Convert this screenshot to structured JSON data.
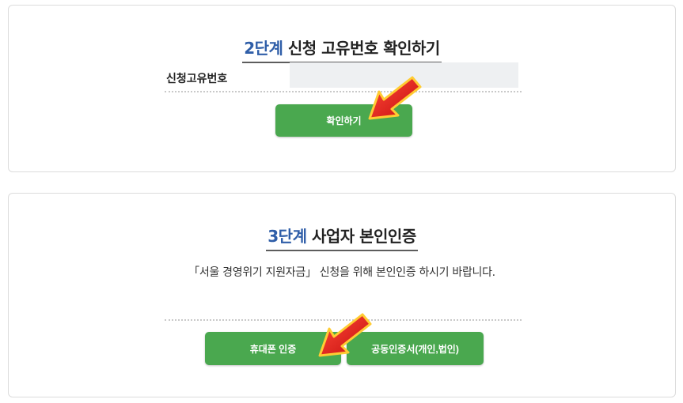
{
  "step2": {
    "step_label": "2단계",
    "title": "신청 고유번호 확인하기",
    "field_label": "신청고유번호",
    "field_value": "",
    "confirm_button": "확인하기"
  },
  "step3": {
    "step_label": "3단계",
    "title": "사업자 본인인증",
    "description": "「서울 경영위기 지원자금」 신청을 위해 본인인증 하시기 바랍니다.",
    "phone_button": "휴대폰 인증",
    "cert_button": "공동인증서(개인,법인)"
  },
  "colors": {
    "step_blue": "#2f5ea8",
    "button_green": "#4aa84f",
    "arrow_red": "#e01b1b",
    "input_bg": "#eef0f2"
  },
  "icons": {
    "annotation_arrows": "red-pointer-arrow-icon"
  }
}
